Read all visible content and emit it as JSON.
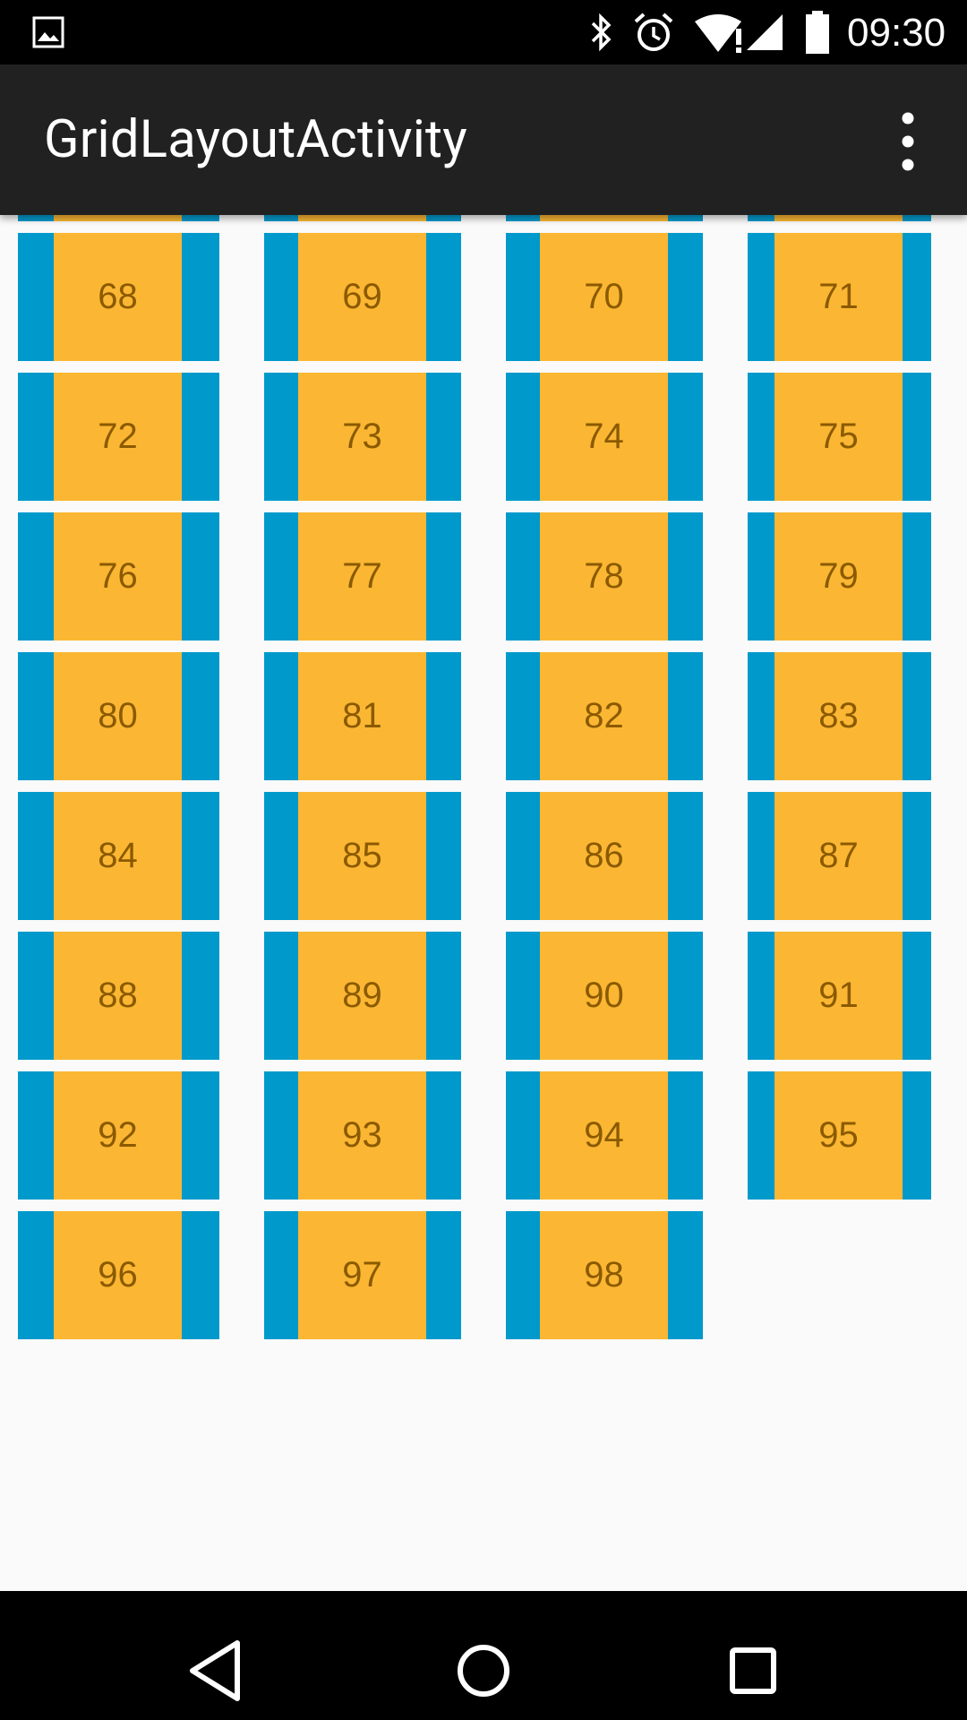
{
  "status_bar": {
    "time": "09:30",
    "icons": [
      "image-icon",
      "bluetooth-icon",
      "alarm-icon",
      "wifi-alert-icon",
      "cellular-signal-icon",
      "battery-icon"
    ]
  },
  "app_bar": {
    "title": "GridLayoutActivity",
    "menu_icon": "overflow-menu-icon"
  },
  "grid": {
    "columns": 4,
    "partial_top_row": [
      "",
      "",
      "",
      ""
    ],
    "items": [
      "68",
      "69",
      "70",
      "71",
      "72",
      "73",
      "74",
      "75",
      "76",
      "77",
      "78",
      "79",
      "80",
      "81",
      "82",
      "83",
      "84",
      "85",
      "86",
      "87",
      "88",
      "89",
      "90",
      "91",
      "92",
      "93",
      "94",
      "95",
      "96",
      "97",
      "98"
    ],
    "colors": {
      "outer": "#0099cc",
      "inner": "#fbb733",
      "text": "#8b5a00"
    }
  },
  "nav_bar": {
    "buttons": [
      "back-icon",
      "home-icon",
      "recents-icon"
    ]
  }
}
